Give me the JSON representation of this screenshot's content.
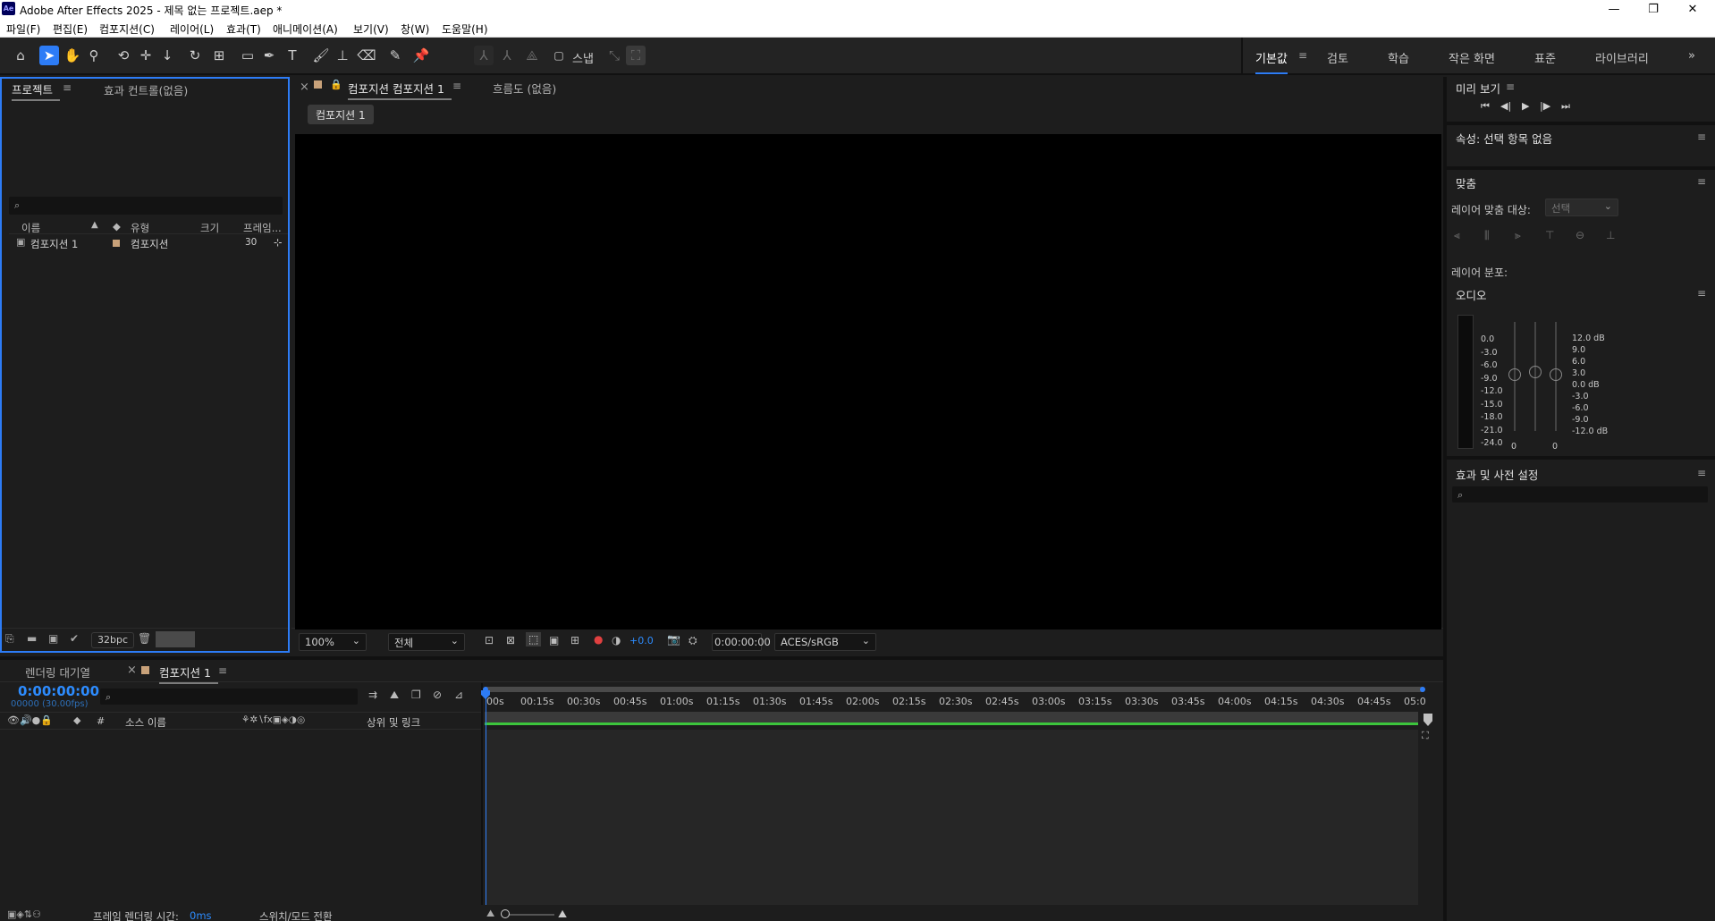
{
  "app": {
    "icon_text": "Ae",
    "title": "Adobe After Effects 2025 - 제목 없는 프로젝트.aep *"
  },
  "window_controls": {
    "minimize": "—",
    "restore": "❐",
    "close": "✕"
  },
  "menu": [
    "파일(F)",
    "편집(E)",
    "컴포지션(C)",
    "레이어(L)",
    "효과(T)",
    "애니메이션(A)",
    "보기(V)",
    "창(W)",
    "도움말(H)"
  ],
  "toolbar": {
    "snap_label": "스냅",
    "workspaces": [
      "기본값",
      "검토",
      "학습",
      "작은 화면",
      "표준",
      "라이브러리"
    ],
    "more": "»"
  },
  "project": {
    "tabs": [
      "프로젝트",
      "효과 컨트롤(없음)"
    ],
    "search_icon": "⌕",
    "columns": [
      "이름",
      "유형",
      "크기",
      "프레임..."
    ],
    "items": [
      {
        "name": "컴포지션 1",
        "type": "컴포지션",
        "size": "",
        "frames": "30",
        "label_color": "#c9a27a"
      }
    ],
    "bpc": "32bpc"
  },
  "viewer": {
    "tabs": [
      "컴포지션 컴포지션 1",
      "흐름도 (없음)"
    ],
    "close": "×",
    "breadcrumb": "컴포지션 1",
    "zoom": "100%",
    "resolution": "전체",
    "exposure": "+0.0",
    "timecode": "0:00:00:00",
    "color_space": "ACES/sRGB"
  },
  "preview": {
    "title": "미리 보기",
    "controls": [
      "⏮",
      "◀|",
      "▶",
      "|▶",
      "⏭"
    ]
  },
  "properties": {
    "title": "속성: 선택 항목 없음"
  },
  "align": {
    "title": "맞춤",
    "align_to_label": "레이어 맞춤 대상:",
    "align_to_value": "선택",
    "distribute_label": "레이어 분포:"
  },
  "audio": {
    "title": "오디오",
    "left_scale": [
      "0.0",
      "-3.0",
      "-6.0",
      "-9.0",
      "-12.0",
      "-15.0",
      "-18.0",
      "-21.0",
      "-24.0"
    ],
    "right_scale": [
      "12.0 dB",
      "9.0",
      "6.0",
      "3.0",
      "0.0 dB",
      "-3.0",
      "-6.0",
      "-9.0",
      "-12.0 dB"
    ],
    "slider_values": [
      "0",
      "0"
    ]
  },
  "effects_presets": {
    "title": "효과 및 사전 설정"
  },
  "timeline": {
    "tabs": [
      "렌더링 대기열",
      "컴포지션 1"
    ],
    "close": "×",
    "current_time": "0:00:00:00",
    "frame_info": "00000 (30.00fps)",
    "columns": {
      "num": "#",
      "source_name": "소스 이름",
      "parent_link": "상위 및 링크"
    },
    "ruler": [
      "00s",
      "00:15s",
      "00:30s",
      "00:45s",
      "01:00s",
      "01:15s",
      "01:30s",
      "01:45s",
      "02:00s",
      "02:15s",
      "02:30s",
      "02:45s",
      "03:00s",
      "03:15s",
      "03:30s",
      "03:45s",
      "04:00s",
      "04:15s",
      "04:30s",
      "04:45s",
      "05:0"
    ],
    "render_time_label": "프레임 렌더링 시간:",
    "render_time_value": "0ms",
    "switch_mode": "스위치/모드 전환"
  },
  "colors": {
    "accent": "#2d7cf6",
    "work_area": "#3cc43c",
    "timecode": "#2d8cff"
  }
}
